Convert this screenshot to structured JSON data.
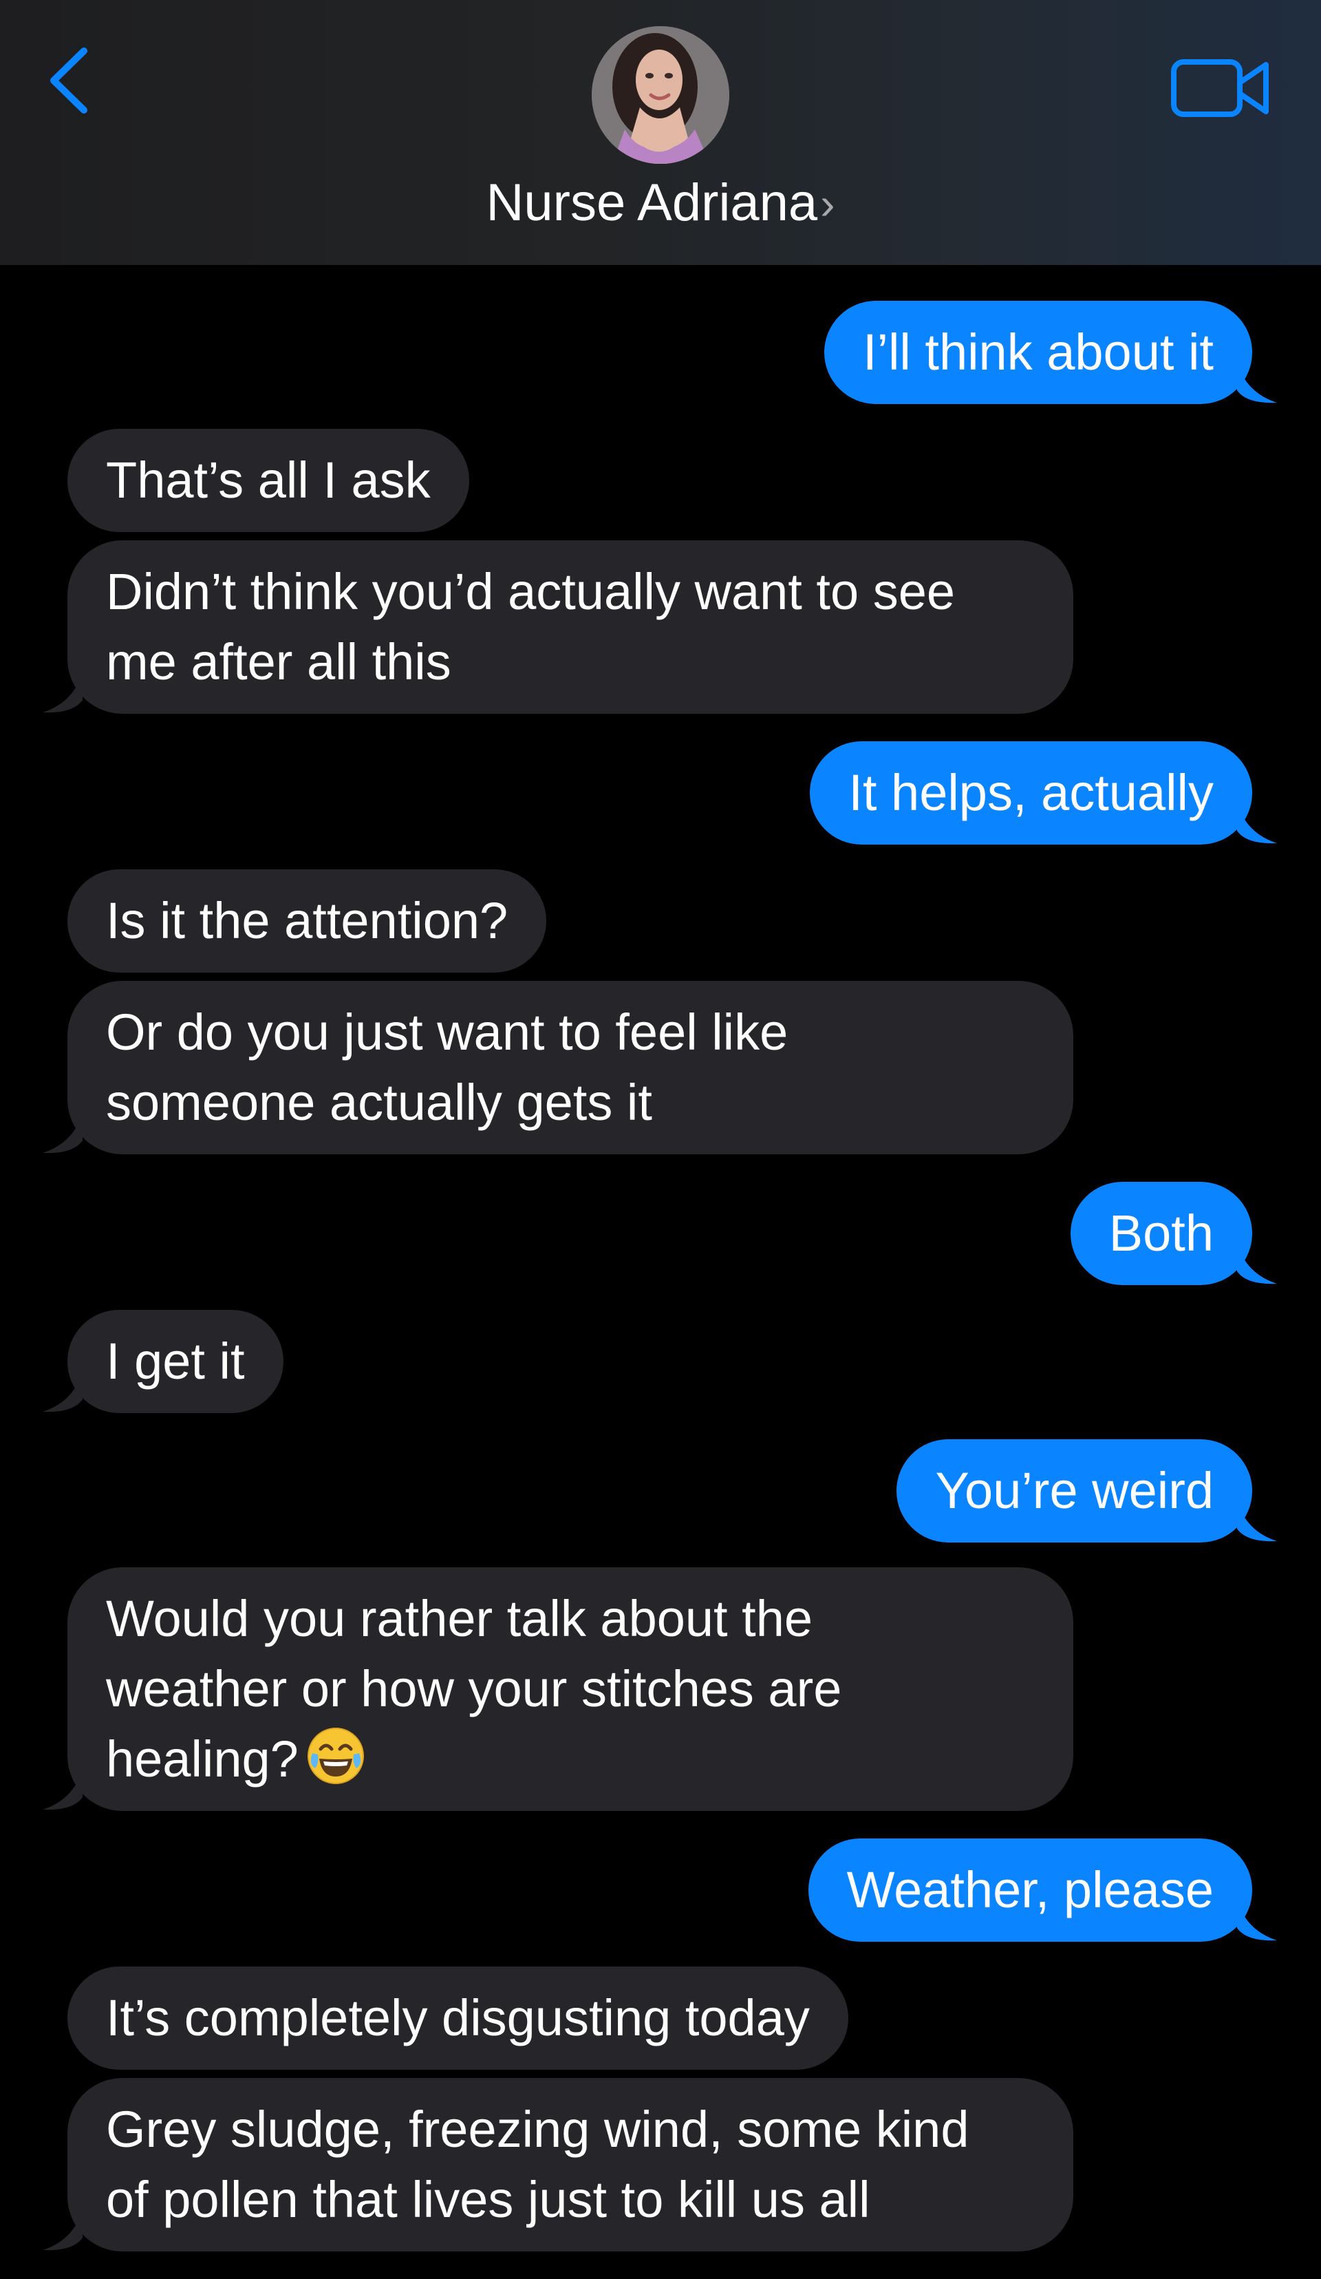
{
  "header": {
    "contact_name": "Nurse Adriana",
    "name_chevron": "›",
    "back_icon": "chevron-left-icon",
    "video_icon": "video-camera-icon",
    "avatar_icon": "contact-avatar"
  },
  "colors": {
    "outgoing_bubble": "#0a84ff",
    "incoming_bubble": "#26252a",
    "accent": "#0a84ff",
    "background": "#000000"
  },
  "messages": [
    {
      "dir": "out",
      "text": "I’ll think about it"
    },
    {
      "dir": "in",
      "text": "That’s all I ask"
    },
    {
      "dir": "in",
      "text": "Didn’t think you’d actually want to see",
      "text2": "me after all this"
    },
    {
      "dir": "out",
      "text": "It helps, actually"
    },
    {
      "dir": "in",
      "text": "Is it the attention?"
    },
    {
      "dir": "in",
      "text": "Or do you just want to feel like",
      "text2": "someone actually gets it"
    },
    {
      "dir": "out",
      "text": "Both"
    },
    {
      "dir": "in",
      "text": "I get it"
    },
    {
      "dir": "out",
      "text": "You’re weird"
    },
    {
      "dir": "in",
      "text": "Would you rather talk about the",
      "text2": "weather or how your stitches are",
      "text3": "healing?",
      "emoji": "face-with-tears-of-joy-icon"
    },
    {
      "dir": "out",
      "text": "Weather, please"
    },
    {
      "dir": "in",
      "text": "It’s completely disgusting today"
    },
    {
      "dir": "in",
      "text": "Grey sludge, freezing wind, some kind",
      "text2": "of pollen that lives just to kill us all"
    }
  ]
}
